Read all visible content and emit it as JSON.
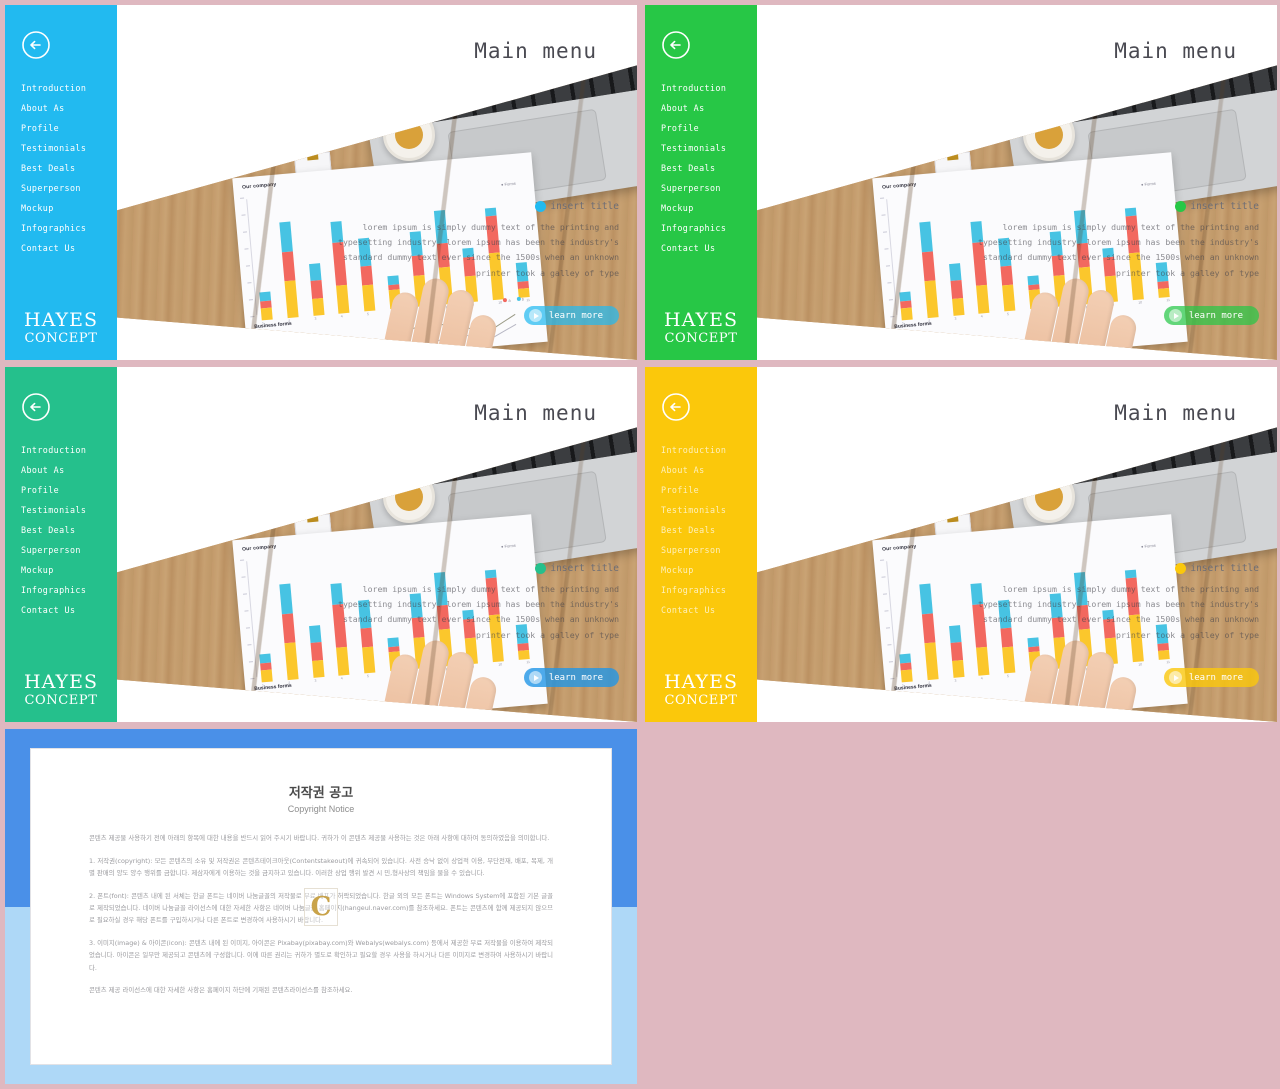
{
  "page": {
    "background_color": "#dfb8c0"
  },
  "slides": [
    {
      "id": "slide-1",
      "accent_color": "#22baf0",
      "accent_soft": "rgba(34,186,240,0.72)",
      "title": "Main menu",
      "insert_title": "insert title",
      "learn_more": "learn more",
      "brand_line1": "HAYES",
      "brand_line2": "CONCEPT",
      "body": "lorem ipsum is simply dummy text of the printing and typesetting industry. lorem ipsum has been the industry's standard dummy text ever since the 1500s when an unknown printer took a galley of type",
      "nav": [
        "Introduction",
        "About As",
        "Profile",
        "Testimonials",
        "Best Deals",
        "Superperson",
        "Mockup",
        "Infographics",
        "Contact Us"
      ],
      "back_icon": "back-arrow-circle-icon",
      "bullet_icon": "circle-plus-icon",
      "play_icon": "play-circle-icon"
    },
    {
      "id": "slide-2",
      "accent_color": "#27c746",
      "accent_soft": "rgba(39,199,70,0.72)",
      "title": "Main menu",
      "insert_title": "insert title",
      "learn_more": "learn more",
      "brand_line1": "HAYES",
      "brand_line2": "CONCEPT",
      "body": "lorem ipsum is simply dummy text of the printing and typesetting industry. lorem ipsum has been the industry's standard dummy text ever since the 1500s when an unknown printer took a galley of type",
      "nav": [
        "Introduction",
        "About As",
        "Profile",
        "Testimonials",
        "Best Deals",
        "Superperson",
        "Mockup",
        "Infographics",
        "Contact Us"
      ],
      "back_icon": "back-arrow-circle-icon",
      "bullet_icon": "circle-plus-icon",
      "play_icon": "play-circle-icon"
    },
    {
      "id": "slide-3",
      "accent_color": "#25c08c",
      "accent_soft": "rgba(37,192,140,0.72)",
      "title": "Main menu",
      "insert_title": "insert title",
      "learn_more": "learn more",
      "brand_line1": "HAYES",
      "brand_line2": "CONCEPT",
      "body": "lorem ipsum is simply dummy text of the printing and typesetting industry. lorem ipsum has been the industry's standard dummy text ever since the 1500s when an unknown printer took a galley of type",
      "nav": [
        "Introduction",
        "About As",
        "Profile",
        "Testimonials",
        "Best Deals",
        "Superperson",
        "Mockup",
        "Infographics",
        "Contact Us"
      ],
      "back_icon": "back-arrow-circle-icon",
      "bullet_icon": "circle-plus-icon",
      "play_icon": "play-circle-icon"
    },
    {
      "id": "slide-4",
      "accent_color": "#fbc80b",
      "accent_soft": "rgba(251,200,11,0.80)",
      "title": "Main menu",
      "insert_title": "insert title",
      "learn_more": "learn more",
      "brand_line1": "HAYES",
      "brand_line2": "CONCEPT",
      "body": "lorem ipsum is simply dummy text of the printing and typesetting industry. lorem ipsum has been the industry's standard dummy text ever since the 1500s when an unknown printer took a galley of type",
      "nav": [
        "Introduction",
        "About As",
        "Profile",
        "Testimonials",
        "Best Deals",
        "Superperson",
        "Mockup",
        "Infographics",
        "Contact Us"
      ],
      "back_icon": "back-arrow-circle-icon",
      "bullet_icon": "circle-plus-icon",
      "play_icon": "play-circle-icon"
    }
  ],
  "copyright_slide": {
    "id": "slide-5",
    "band_top_color": "#4a90e8",
    "band_bottom_color": "#aed8f7",
    "watermark": "C",
    "heading_ko": "저작권 공고",
    "heading_en": "Copyright Notice",
    "paragraphs": [
      "콘텐츠 제공물 사용하기 전에 아래의 항목에 대한 내용을 반드시 읽어 주시기 바랍니다. 귀하가 이 콘텐츠 제공물 사용하는 것은 아래 사항에 대하여 동의하였음을 의미합니다.",
      "1. 저작권(copyright): 모든 콘텐츠의 소유 및 저작권은 콘텐츠테이크아웃(Contentstakeout)에 귀속되어 있습니다. 사전 승낙 없이 상업적 이용, 무단전재, 배포, 복제, 개별 판매의 양도 양수 행위를 금합니다. 제삼자에게 이용하는 것을 금지하고 있습니다. 이러한 상업 행위 발견 시 민,형사상의 책임을 물을 수 있습니다.",
      "2. 폰트(font): 콘텐츠 내에 된 서체는 한글 폰트는 네이버 나눔글꼴의 저작물로 무료 배포가 허락되었습니다. 한글 외의 모든 폰트는 Windows System에 포함된 기본 글꼴로 제작되었습니다. 네이버 나눔글꼴 라이선스에 대한 자세한 사항은 네이버 나눔글꼴 홈페이지(hangeul.naver.com)를 참조하세요. 폰트는 콘텐츠에 함께 제공되지 않으므로 필요하실 경우 해당 폰트를 구입하시거나 다른 폰트로 변경하여 사용하시기 바랍니다.",
      "3. 이미지(image) & 아이콘(icon): 콘텐츠 내에 된 이미지, 아이콘은 Pixabay(pixabay.com)와 Webalys(webalys.com) 등에서 제공한 무료 저작물을 이용하여 제작되었습니다. 아이콘은 일부만 제공되고 콘텐츠에 구성합니다. 이에 따른 권리는 귀하가 별도로 확인하고 필요할 경우 사용을 하시거나 다른 이미지로 변경하여 사용하시기 바랍니다.",
      "콘텐츠 제공 라이선스에 대한 자세한 사항은 홈페이지 하단에 기재된 콘텐츠라이선스를 참조하세요."
    ]
  },
  "chart_data": {
    "type": "bar",
    "title": "Our company",
    "subtitle": "Business forms",
    "stacked": true,
    "categories": [
      "1",
      "2",
      "3",
      "4",
      "5",
      "6",
      "7",
      "8",
      "9",
      "10",
      "11"
    ],
    "series": [
      {
        "name": "yellow",
        "color": "#fbc72c",
        "values": [
          14,
          42,
          20,
          32,
          30,
          22,
          36,
          42,
          30,
          54,
          10
        ]
      },
      {
        "name": "red",
        "color": "#f2685f",
        "values": [
          8,
          34,
          20,
          50,
          22,
          6,
          22,
          28,
          22,
          42,
          8
        ]
      },
      {
        "name": "cyan",
        "color": "#47c3e3",
        "values": [
          10,
          34,
          20,
          24,
          32,
          10,
          28,
          38,
          10,
          10,
          22
        ]
      }
    ],
    "ylim": [
      0,
      140
    ],
    "grid": false,
    "legend_position": "top-right"
  }
}
